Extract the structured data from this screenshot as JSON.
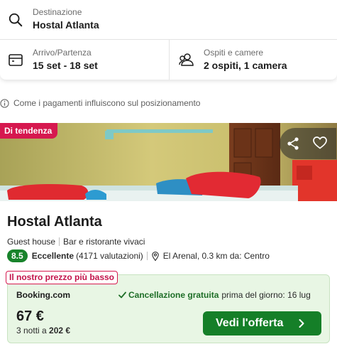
{
  "destination": {
    "label": "Destinazione",
    "value": "Hostal Atlanta"
  },
  "dates": {
    "label": "Arrivo/Partenza",
    "value": "15 set - 18 set"
  },
  "guests": {
    "label": "Ospiti e camere",
    "value": "2 ospiti, 1 camera"
  },
  "info_text": "Come i pagamenti influiscono sul posizionamento",
  "result": {
    "badge": "Di tendenza",
    "name": "Hostal Atlanta",
    "type": "Guest house",
    "feature": "Bar e ristorante vivaci",
    "rating_score": "8.5",
    "rating_word": "Eccellente",
    "rating_count": "(4171 valutazioni)",
    "location": "El Arenal, 0.3 km da: Centro",
    "deal": {
      "badge": "Il nostro prezzo più basso",
      "provider": "Booking.com",
      "cancel_strong": "Cancellazione gratuita",
      "cancel_rest": "prima del giorno: 16 lug",
      "price": "67 €",
      "nights_prefix": "3 notti a",
      "nights_total": "202 €",
      "cta_label": "Vedi l'offerta"
    }
  },
  "colors": {
    "trend_badge": "#d6184f",
    "rating_badge": "#18832b",
    "deal_bg": "#e8f6e4",
    "cta": "#157f28"
  },
  "icons": {
    "destination": "search-icon",
    "dates": "calendar-icon",
    "guests": "people-icon",
    "info": "info-icon",
    "share": "share-icon",
    "favorite": "heart-icon",
    "location": "location-pin-icon",
    "cancel": "check-icon",
    "cta": "chevron-right-icon"
  }
}
